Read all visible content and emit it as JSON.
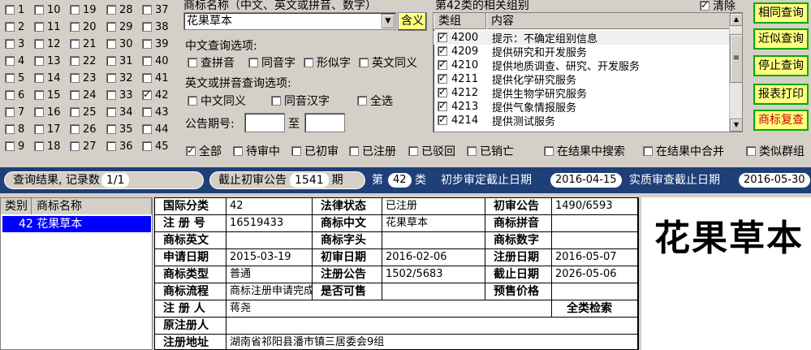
{
  "classes": [
    "1",
    "2",
    "3",
    "4",
    "5",
    "6",
    "7",
    "8",
    "9",
    "10",
    "11",
    "12",
    "13",
    "14",
    "15",
    "16",
    "17",
    "18",
    "19",
    "20",
    "21",
    "22",
    "23",
    "24",
    "25",
    "26",
    "27",
    "28",
    "29",
    "30",
    "31",
    "32",
    "33",
    "34",
    "35",
    "36",
    "37",
    "38",
    "39",
    "40",
    "41",
    "42",
    "43",
    "44",
    "45"
  ],
  "checked_class": "42",
  "name_label": "商标名称（中文、英文或拼音、数字）",
  "name_value": "花果草本",
  "meaning_button": "含义",
  "cn_options_label": "中文查询选项:",
  "cn_options": [
    "查拼音",
    "同音字",
    "形似字",
    "英文同义"
  ],
  "en_options_label": "英文或拼音查询选项:",
  "en_options": [
    "中文同义",
    "同音汉字",
    "全选"
  ],
  "issue_label": "公告期号:",
  "issue_to": "至",
  "group_title": "第42类的相关组别",
  "clear_label": "清除",
  "group_headers": [
    "类组",
    "内容"
  ],
  "groups": [
    {
      "code": "4200",
      "desc": "提示：不确定组别信息"
    },
    {
      "code": "4209",
      "desc": "提供研究和开发服务"
    },
    {
      "code": "4210",
      "desc": "提供地质调查、研究、开发服务"
    },
    {
      "code": "4211",
      "desc": "提供化学研究服务"
    },
    {
      "code": "4212",
      "desc": "提供生物学研究服务"
    },
    {
      "code": "4213",
      "desc": "提供气象情报服务"
    },
    {
      "code": "4214",
      "desc": "提供测试服务"
    }
  ],
  "buttons": [
    "相同查询",
    "近似查询",
    "停止查询",
    "报表打印",
    "商标复查"
  ],
  "filters": [
    "全部",
    "待审中",
    "已初审",
    "已注册",
    "已驳回",
    "已销亡",
    "在结果中搜索",
    "在结果中合并",
    "类似群组"
  ],
  "status": {
    "result_label": "查询结果, 记录数",
    "result_count": "1/1",
    "deadline_label": "截止初审公告",
    "deadline_value": "1541",
    "deadline_unit": "期",
    "class_prefix": "第",
    "class_value": "42",
    "class_suffix": "类",
    "prelim_label": "初步审定截止日期",
    "prelim_value": "2016-04-15",
    "substantive_label": "实质审查截止日期",
    "substantive_value": "2016-05-30"
  },
  "result_list": {
    "headers": [
      "类别",
      "商标名称"
    ],
    "row": "42 花果草本"
  },
  "detail": {
    "intl_class_label": "国际分类",
    "intl_class": "42",
    "legal_status_label": "法律状态",
    "legal_status": "已注册",
    "prelim_pub_label": "初审公告",
    "prelim_pub": "1490/6593",
    "reg_no_label": "注 册 号",
    "reg_no": "16519433",
    "cn_name_label": "商标中文",
    "cn_name": "花果草本",
    "pinyin_label": "商标拼音",
    "pinyin": "",
    "en_name_label": "商标英文",
    "en_name": "",
    "head_label": "商标字头",
    "head": "",
    "digit_label": "商标数字",
    "digit": "",
    "apply_date_label": "申请日期",
    "apply_date": "2015-03-19",
    "prelim_date_label": "初审日期",
    "prelim_date": "2016-02-06",
    "reg_date_label": "注册日期",
    "reg_date": "2016-05-07",
    "type_label": "商标类型",
    "type": "普通",
    "reg_pub_label": "注册公告",
    "reg_pub": "1502/5683",
    "expiry_label": "截止日期",
    "expiry": "2026-05-06",
    "process_label": "商标流程",
    "process": "商标注册申请完成",
    "sellable_label": "是否可售",
    "sellable": "",
    "price_label": "预售价格",
    "price": "",
    "registrant_label": "注 册 人",
    "registrant": "蒋尧",
    "full_search": "全类检索",
    "original_label": "原注册人",
    "original": "",
    "address_label": "注册地址",
    "address": "湖南省祁阳县潘市镇三居委会9组"
  },
  "preview_mark": "花果草本"
}
